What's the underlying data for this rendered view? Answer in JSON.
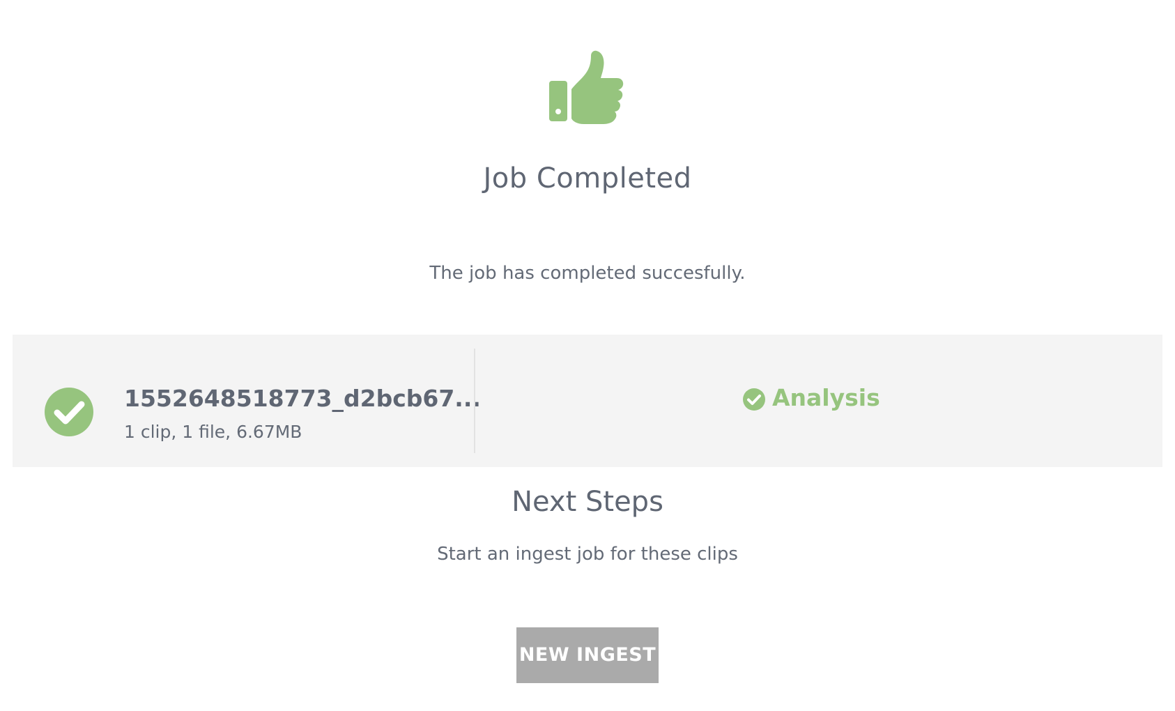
{
  "hero": {
    "icon": "thumbs-up-icon",
    "title": "Job Completed",
    "message": "The job has completed succesfully."
  },
  "job": {
    "status_icon": "check-circle-icon",
    "name": "1552648518773_d2bcb67...",
    "stats": "1 clip, 1 file, 6.67MB"
  },
  "analysis": {
    "status_icon": "check-circle-icon",
    "label": "Analysis"
  },
  "next_steps": {
    "title": "Next Steps",
    "description": "Start an ingest job for these clips",
    "button_label": "NEW INGEST"
  },
  "colors": {
    "accent_green": "#96c47e",
    "text_gray": "#636a76",
    "panel_bg": "#f4f4f4",
    "button_bg": "#aaaaaa"
  }
}
